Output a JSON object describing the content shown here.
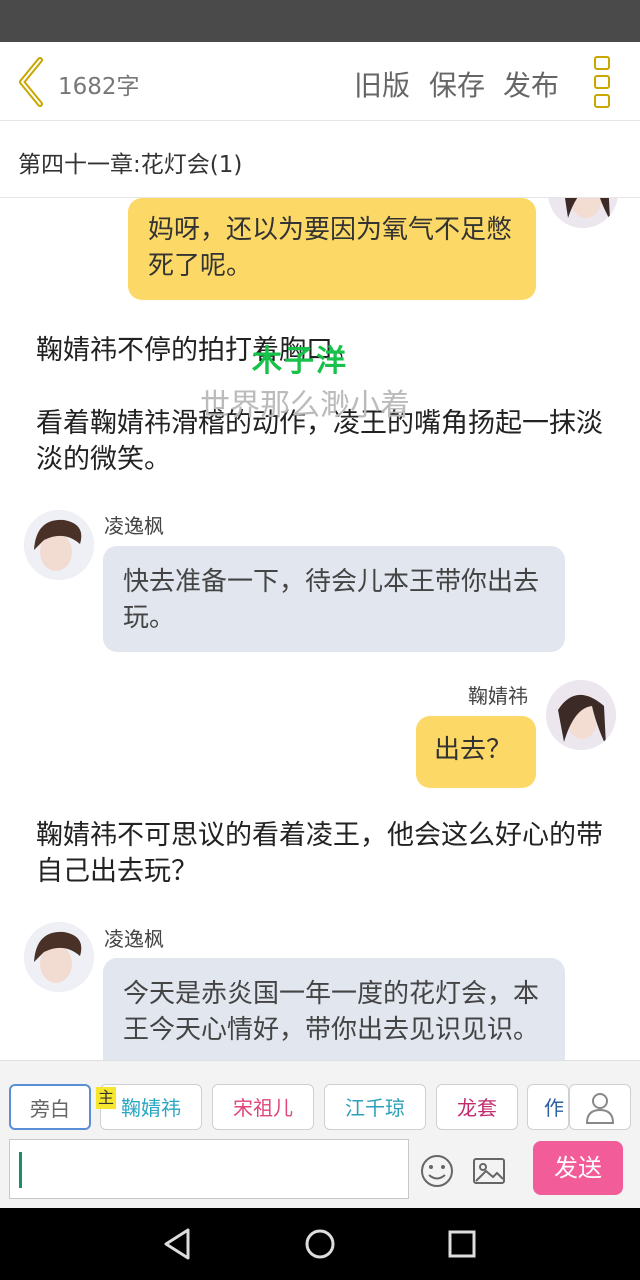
{
  "header": {
    "word_count": "1682字",
    "old_version": "旧版",
    "save": "保存",
    "publish": "发布"
  },
  "chapter_title": "第四十一章:花灯会(1)",
  "messages": [
    {
      "type": "bubble",
      "side": "right",
      "text": "妈呀，还以为要因为氧气不足憋死了呢。"
    },
    {
      "type": "narration",
      "text": "鞠婧祎不停的拍打着胸口。"
    },
    {
      "type": "narration",
      "text": "看着鞠婧祎滑稽的动作，凌王的嘴角扬起一抹淡淡的微笑。"
    },
    {
      "type": "bubble",
      "side": "left",
      "name": "凌逸枫",
      "text": "快去准备一下，待会儿本王带你出去玩。"
    },
    {
      "type": "bubble",
      "side": "right",
      "name": "鞠婧祎",
      "text": "出去？"
    },
    {
      "type": "narration",
      "text": "鞠婧祎不可思议的看着凌王，他会这么好心的带自己出去玩？"
    },
    {
      "type": "bubble",
      "side": "left",
      "name": "凌逸枫",
      "text": "今天是赤炎国一年一度的花灯会，本王今天心情好，带你出去见识见识。"
    }
  ],
  "watermark": {
    "line1": "木子洋",
    "line2": "世界那么渺小着"
  },
  "characters": {
    "narrator": "旁白",
    "main_badge": "主",
    "items": [
      {
        "label": "鞠婧祎",
        "color": "#2aa6c2"
      },
      {
        "label": "宋祖儿",
        "color": "#e0457b"
      },
      {
        "label": "江千琼",
        "color": "#2ba0b8"
      },
      {
        "label": "龙套",
        "color": "#c02c6e"
      },
      {
        "label": "作",
        "color": "#2b5fa6"
      }
    ]
  },
  "composer": {
    "send": "发送"
  },
  "icons": [
    "back-chevron-icon",
    "more-menu-icon",
    "person-icon",
    "emoji-icon",
    "image-icon",
    "nav-back-icon",
    "nav-home-icon",
    "nav-recents-icon"
  ]
}
